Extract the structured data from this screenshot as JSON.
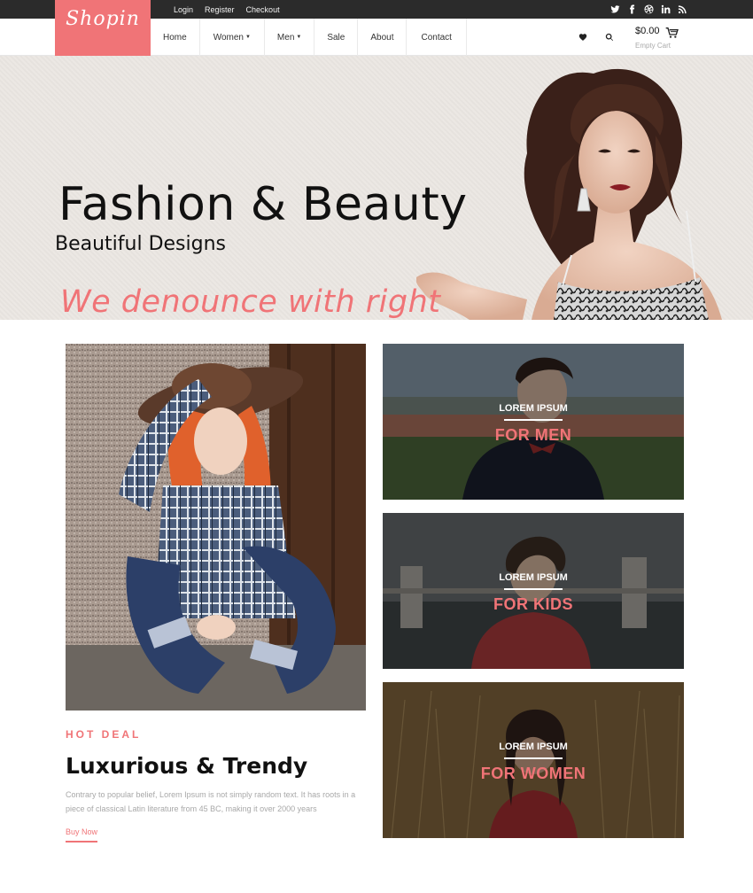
{
  "topbar": {
    "links": [
      "Login",
      "Register",
      "Checkout"
    ],
    "social_icons": [
      "twitter-icon",
      "facebook-icon",
      "dribbble-icon",
      "linkedin-icon",
      "rss-icon"
    ]
  },
  "brand": {
    "logo": "Shopin"
  },
  "nav": {
    "items": [
      {
        "label": "Home",
        "dropdown": false
      },
      {
        "label": "Women",
        "dropdown": true
      },
      {
        "label": "Men",
        "dropdown": true
      },
      {
        "label": "Sale",
        "dropdown": false
      },
      {
        "label": "About",
        "dropdown": false
      },
      {
        "label": "Contact",
        "dropdown": false
      }
    ]
  },
  "cart": {
    "total": "$0.00",
    "status": "Empty Cart"
  },
  "hero": {
    "title": "Fashion & Beauty",
    "subtitle": "Beautiful Designs",
    "tagline": "We denounce with right"
  },
  "deal": {
    "kicker": "HOT DEAL",
    "title": "Luxurious & Trendy",
    "text": "Contrary to popular belief, Lorem Ipsum is not simply random text. It has roots in a piece of classical Latin literature from 45 BC, making it over 2000 years",
    "cta": "Buy Now"
  },
  "categories": [
    {
      "small": "LOREM IPSUM",
      "big": "FOR MEN"
    },
    {
      "small": "LOREM IPSUM",
      "big": "FOR KIDS"
    },
    {
      "small": "LOREM IPSUM",
      "big": "FOR WOMEN"
    }
  ],
  "colors": {
    "accent": "#f07477",
    "topbar": "#2b2b2b",
    "hero_bg": "#ebe7e2"
  }
}
